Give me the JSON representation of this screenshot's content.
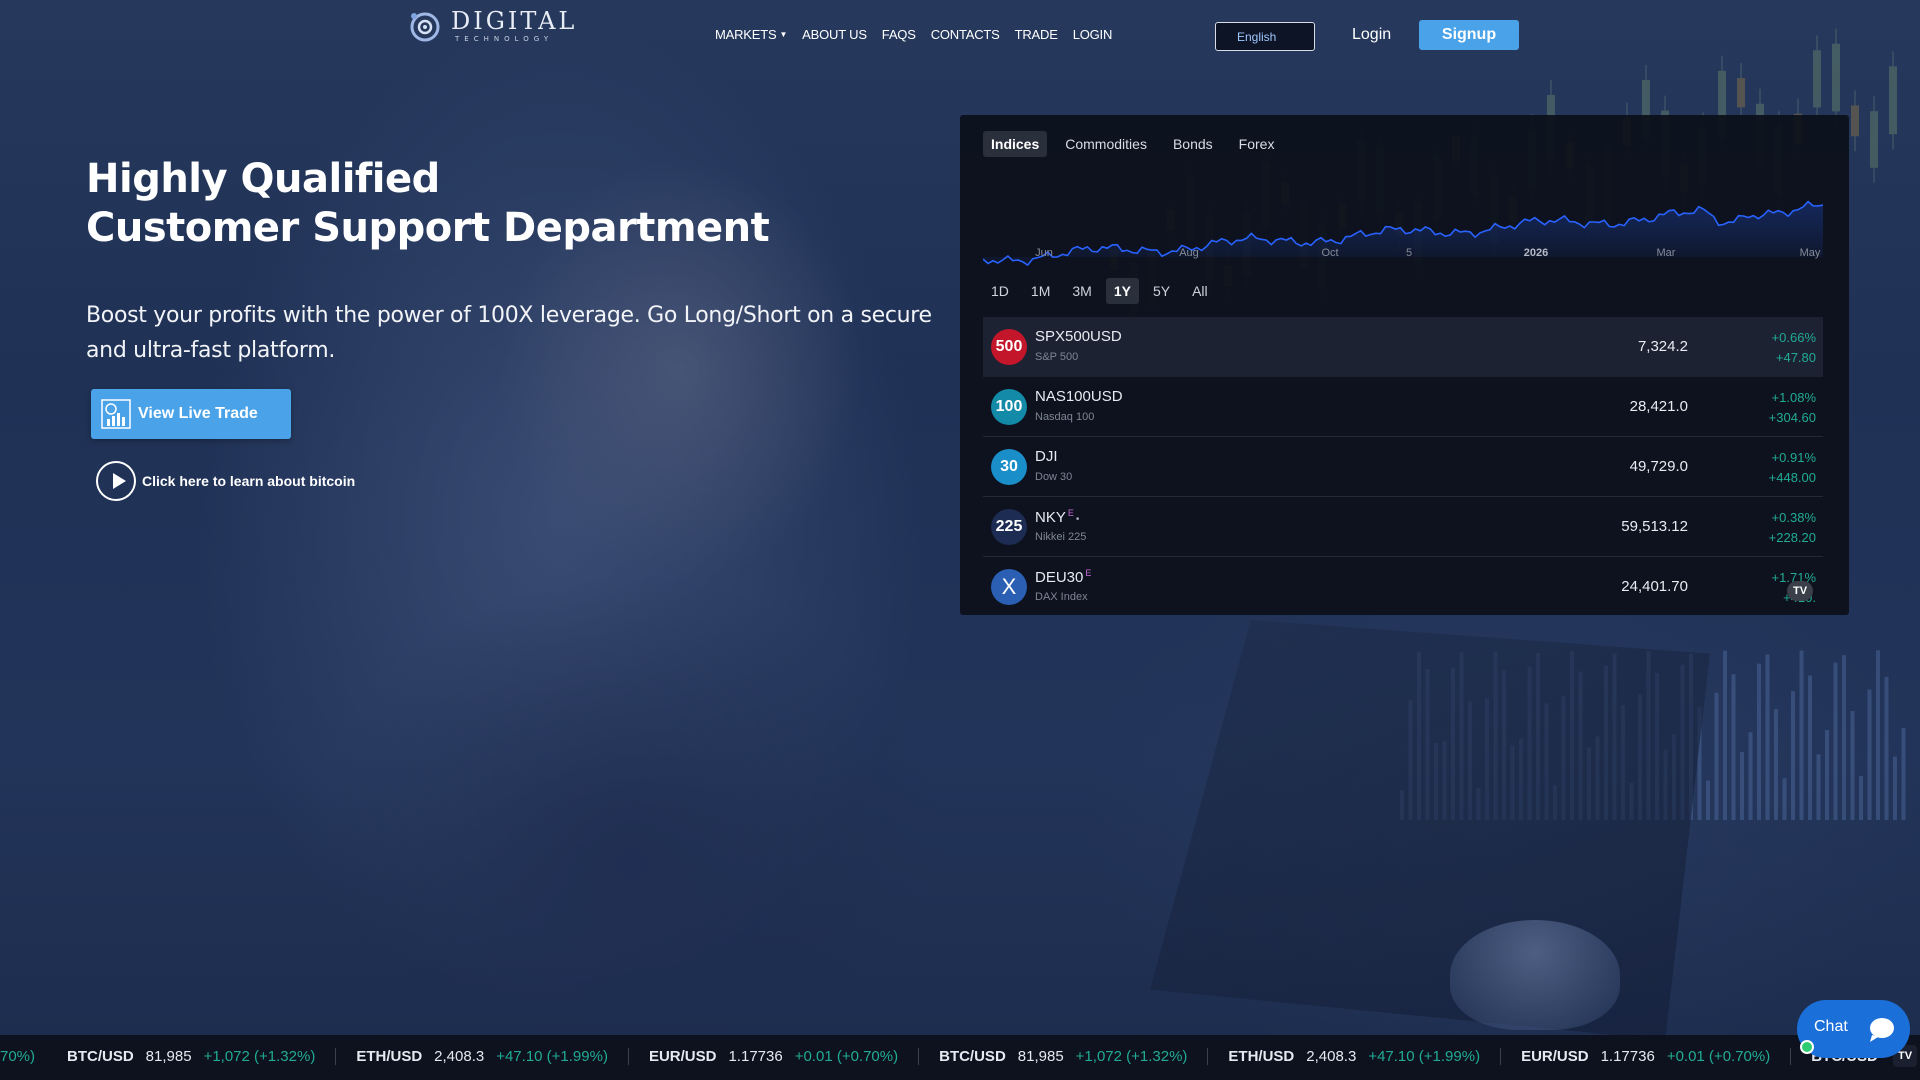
{
  "brand": {
    "line1": "DIGITAL",
    "line2": "TECHNOLOGY"
  },
  "nav": {
    "items": [
      "MARKETS",
      "ABOUT US",
      "FAQS",
      "CONTACTS",
      "TRADE",
      "LOGIN"
    ]
  },
  "header": {
    "language": "English",
    "login": "Login",
    "signup": "Signup"
  },
  "hero": {
    "title_line1": "Highly Qualified",
    "title_line2": "Customer Support Department",
    "subtitle": "Boost your profits with the power of 100X leverage. Go Long/Short on a secure and ultra-fast platform.",
    "cta": "View Live Trade",
    "learn": "Click here to learn about bitcoin"
  },
  "widget": {
    "tabs": [
      "Indices",
      "Commodities",
      "Bonds",
      "Forex"
    ],
    "active_tab": "Indices",
    "axis_labels": [
      "Jun",
      "Aug",
      "Oct",
      "5",
      "2026",
      "Mar",
      "May"
    ],
    "ranges": [
      "1D",
      "1M",
      "3M",
      "1Y",
      "5Y",
      "All"
    ],
    "active_range": "1Y",
    "line_color": "#2962ff",
    "rows": [
      {
        "badge": "500",
        "badge_color": "#c4162a",
        "symbol": "SPX500USD",
        "sup": "",
        "desc": "S&P 500",
        "price": "7,324.2",
        "pct": "+0.66%",
        "abs": "+47.80"
      },
      {
        "badge": "100",
        "badge_color": "#138aa8",
        "symbol": "NAS100USD",
        "sup": "",
        "desc": "Nasdaq 100",
        "price": "28,421.0",
        "pct": "+1.08%",
        "abs": "+304.60"
      },
      {
        "badge": "30",
        "badge_color": "#1a8ec9",
        "symbol": "DJI",
        "sup": "",
        "desc": "Dow 30",
        "price": "49,729.0",
        "pct": "+0.91%",
        "abs": "+448.00"
      },
      {
        "badge": "225",
        "badge_color": "#1d2c52",
        "symbol": "NKY",
        "sup": "E",
        "desc": "Nikkei 225",
        "price": "59,513.12",
        "pct": "+0.38%",
        "abs": "+228.20"
      },
      {
        "badge": "X",
        "badge_color": "#2a5fb3",
        "symbol": "DEU30",
        "sup": "E",
        "desc": "DAX Index",
        "price": "24,401.70",
        "pct": "+1.71%",
        "abs": "+410."
      }
    ],
    "tv_badge": "TV"
  },
  "ticker": {
    "head": "70%)",
    "items": [
      {
        "sym": "BTC/USD",
        "price": "81,985",
        "chg": "+1,072 (+1.32%)"
      },
      {
        "sym": "ETH/USD",
        "price": "2,408.3",
        "chg": "+47.10 (+1.99%)"
      },
      {
        "sym": "EUR/USD",
        "price": "1.17736",
        "chg": "+0.01 (+0.70%)"
      },
      {
        "sym": "BTC/USD",
        "price": "81,985",
        "chg": "+1,072 (+1.32%)"
      },
      {
        "sym": "ETH/USD",
        "price": "2,408.3",
        "chg": "+47.10 (+1.99%)"
      },
      {
        "sym": "EUR/USD",
        "price": "1.17736",
        "chg": "+0.01 (+0.70%)"
      },
      {
        "sym": "BTC/USD",
        "price": "",
        "chg": ""
      }
    ],
    "up_color": "#22ab94"
  },
  "chat": {
    "label": "Chat"
  }
}
